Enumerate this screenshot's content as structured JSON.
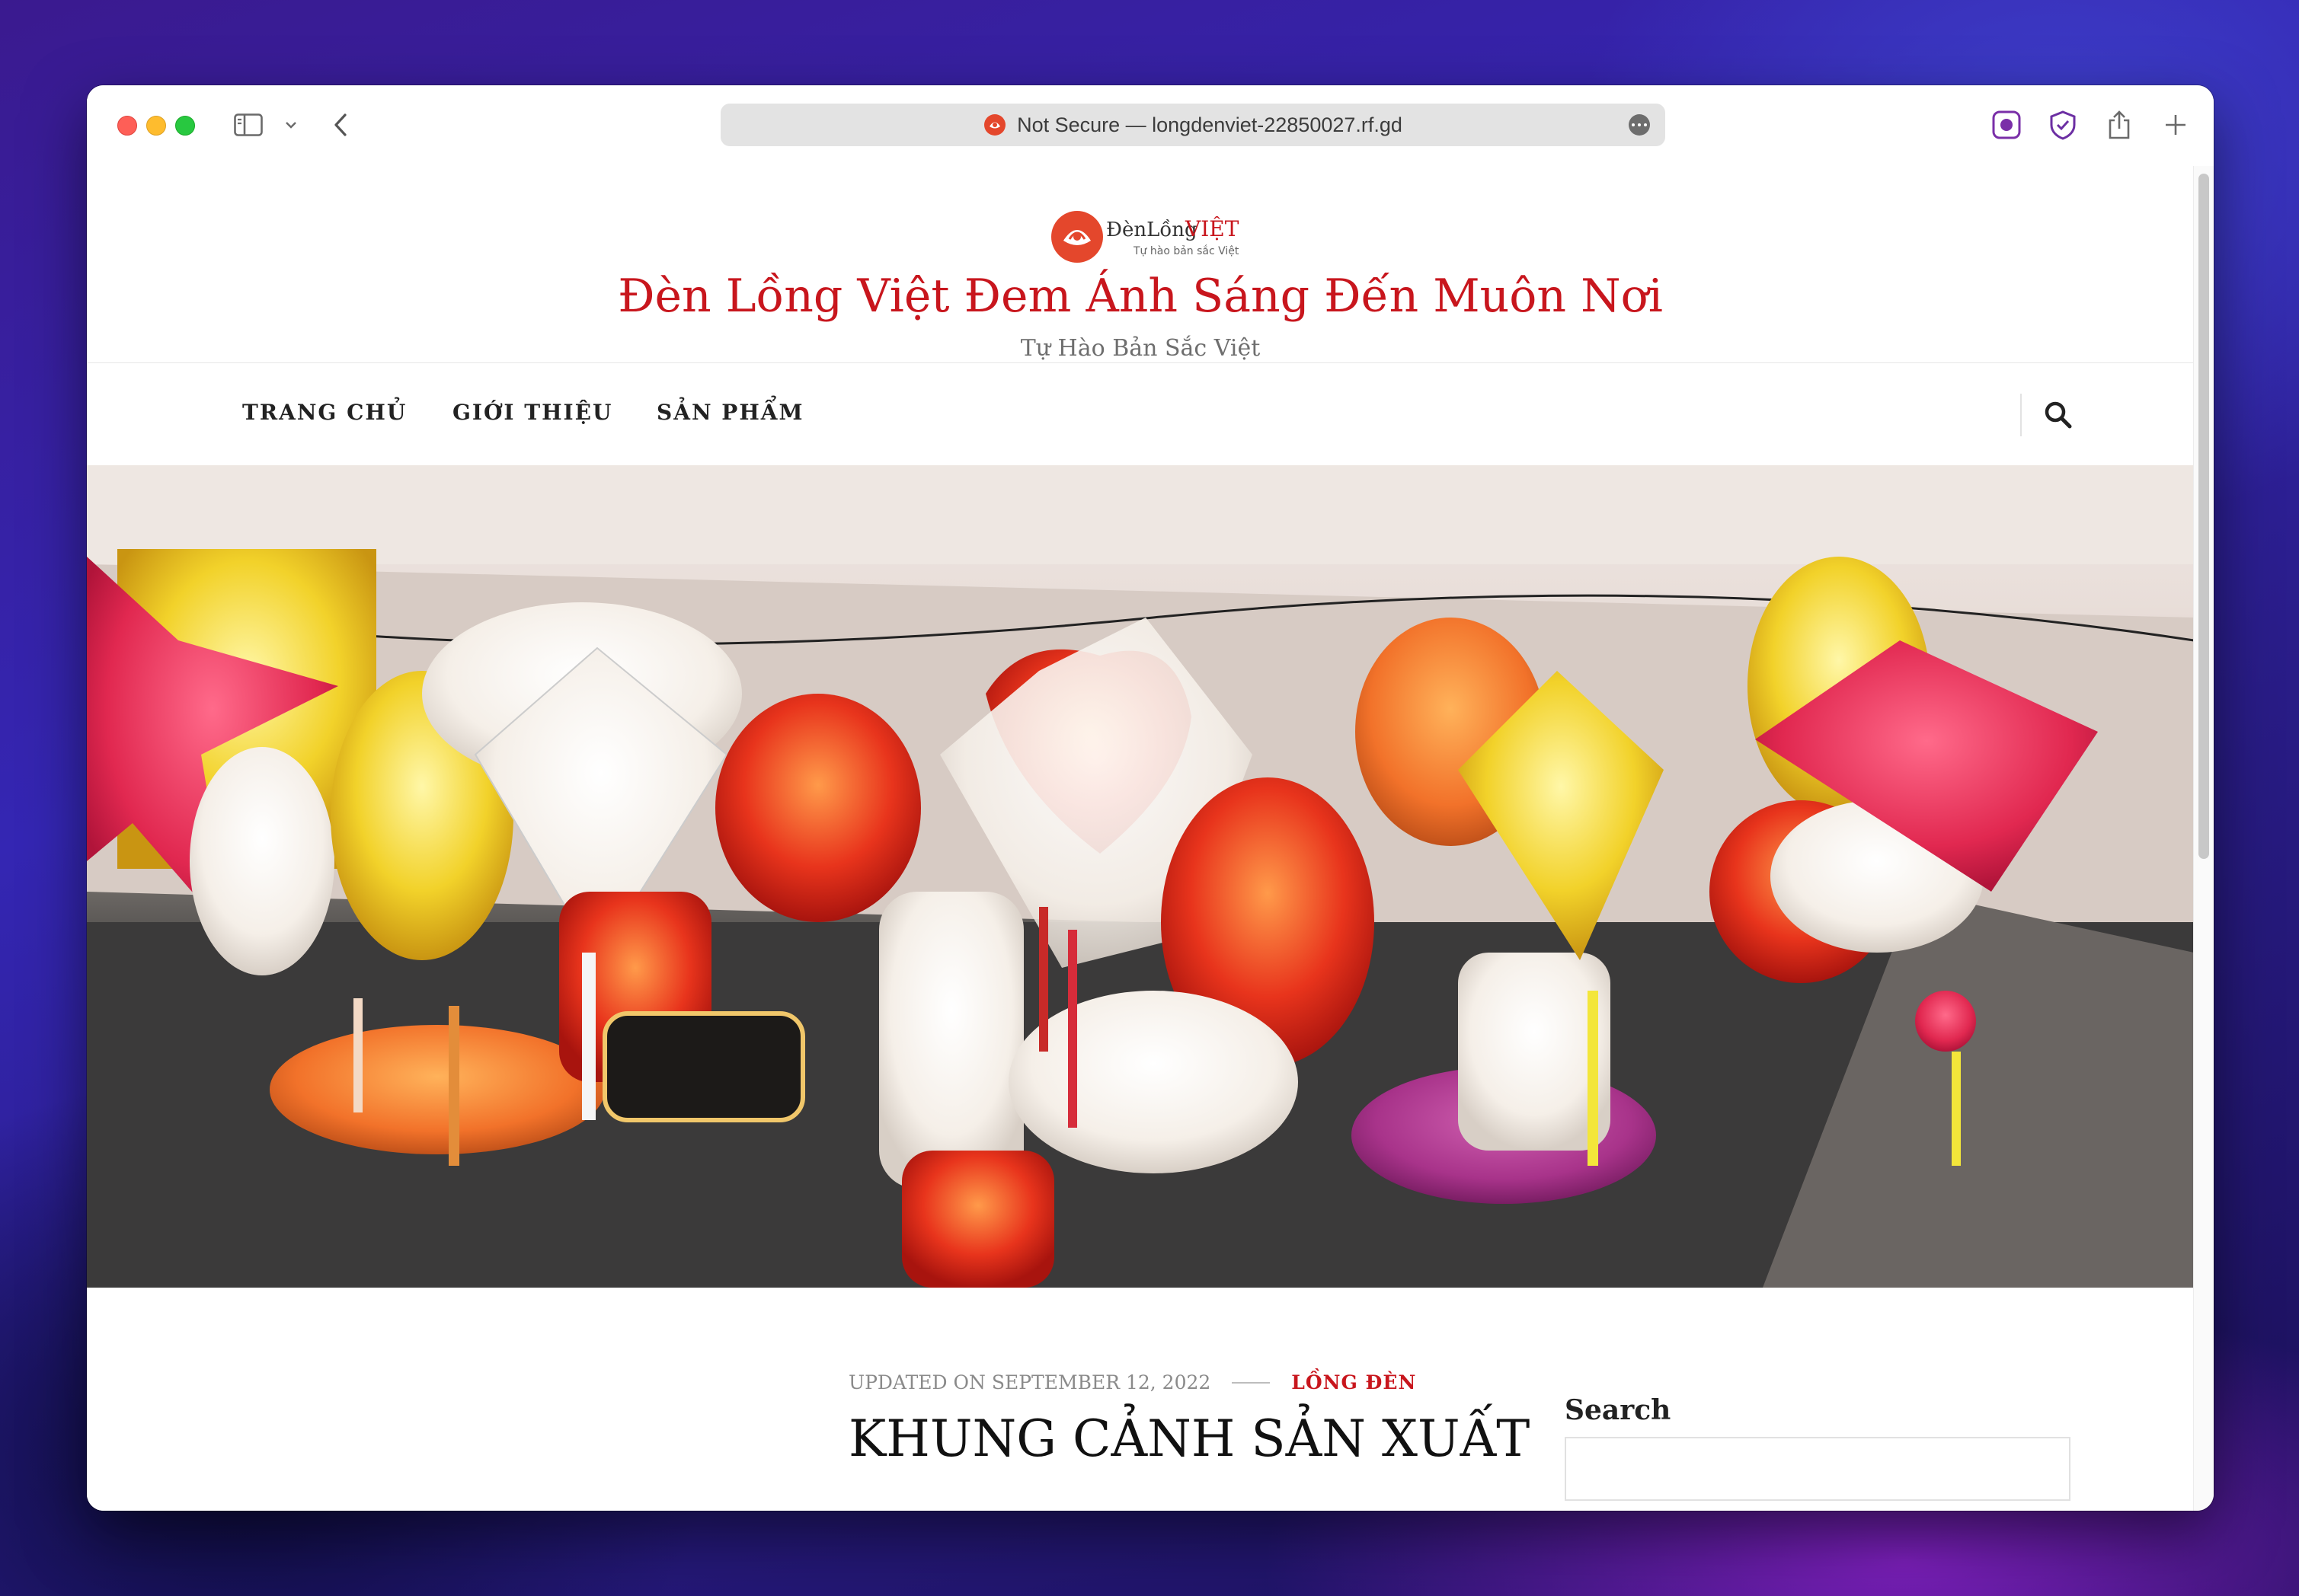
{
  "browser": {
    "url_text": "Not Secure — longdenviet-22850027.rf.gd",
    "icons": [
      "sidebar-icon",
      "chevron-down-icon",
      "back-icon",
      "site-favicon-icon",
      "more-icon",
      "extension-icon",
      "shield-check-icon",
      "share-icon",
      "plus-icon"
    ]
  },
  "site": {
    "logo_text": "ĐènLồngVIỆT",
    "logo_tagline": "Tự hào bản sắc Việt",
    "title": "Đèn Lồng Việt Đem Ánh Sáng Đến Muôn Nơi",
    "description": "Tự Hào Bản Sắc Việt",
    "brand_color": "#c8161d"
  },
  "nav": {
    "items": [
      {
        "label": "TRANG CHỦ"
      },
      {
        "label": "GIỚI THIỆU"
      },
      {
        "label": "SẢN PHẨM"
      }
    ],
    "search_icon": "search-icon"
  },
  "post": {
    "updated": "UPDATED ON SEPTEMBER 12, 2022",
    "category": "LỒNG ĐÈN",
    "title": "KHUNG CẢNH SẢN XUẤT"
  },
  "sidebar": {
    "widget_title": "Search"
  }
}
